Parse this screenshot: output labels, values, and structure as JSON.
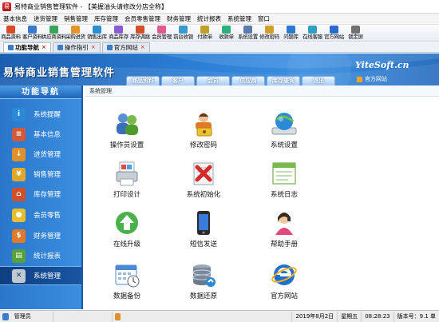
{
  "window": {
    "title": "易特商业销售管理软件 - 【美握油头请修改分店全称】"
  },
  "menubar": {
    "items": [
      "基本信息",
      "进货管理",
      "销售管理",
      "库存管理",
      "会员零售管理",
      "财务管理",
      "统计报表",
      "系统管理",
      "窗口"
    ]
  },
  "toolbar": {
    "items": [
      {
        "label": "商品资料",
        "icon": "product-icon",
        "color": "#d94a2a"
      },
      {
        "label": "客户资料",
        "icon": "customer-icon",
        "color": "#3a7bd0"
      },
      {
        "label": "供应商资料",
        "icon": "supplier-icon",
        "color": "#3aa35a"
      },
      {
        "label": "采购进货",
        "icon": "purchase-icon",
        "color": "#e0962a"
      },
      {
        "label": "销售出库",
        "icon": "sales-out-icon",
        "color": "#2a8fd0"
      },
      {
        "label": "商品库存",
        "icon": "inventory-icon",
        "color": "#8a5ad0"
      },
      {
        "label": "库存调拨",
        "icon": "transfer-icon",
        "color": "#d0502a"
      },
      {
        "label": "会员管理",
        "icon": "member-icon",
        "color": "#e05a8a"
      },
      {
        "label": "前台收银",
        "icon": "cashier-icon",
        "color": "#3a9ad0"
      },
      {
        "label": "付款单",
        "icon": "payment-icon",
        "color": "#c0a02a"
      },
      {
        "label": "收款单",
        "icon": "receipt-icon",
        "color": "#2ab07a"
      },
      {
        "label": "系统设置",
        "icon": "settings-icon",
        "color": "#5a7ab0"
      },
      {
        "label": "修改密码",
        "icon": "password-icon",
        "color": "#d0a02a"
      },
      {
        "label": "问题库",
        "icon": "help-icon",
        "color": "#2a7ad0"
      },
      {
        "label": "在线客服",
        "icon": "service-icon",
        "color": "#30a0c0"
      },
      {
        "label": "官方网站",
        "icon": "website-icon",
        "color": "#2a6ad0"
      },
      {
        "label": "锁定屏",
        "icon": "lock-icon",
        "color": "#707070"
      }
    ]
  },
  "tabs": [
    {
      "label": "功能导航",
      "active": true
    },
    {
      "label": "操作指引",
      "active": false
    },
    {
      "label": "官方网站",
      "active": false
    }
  ],
  "banner": {
    "app_title": "易特商业销售管理软件",
    "brand": "YiteSoft.cn",
    "home_link": "官方网站",
    "nav_tabs": [
      "商品资料",
      "客户",
      "会员",
      "供应商",
      "库存查询",
      "退出"
    ]
  },
  "sidebar": {
    "header": "功能导航",
    "items": [
      {
        "label": "系统提醒",
        "icon": "info-icon",
        "color": "#2a8ad8",
        "glyph": "i",
        "active": false
      },
      {
        "label": "基本信息",
        "icon": "basic-info-icon",
        "color": "#d05a3a",
        "glyph": "≡",
        "active": false
      },
      {
        "label": "进货管理",
        "icon": "stock-in-icon",
        "color": "#e0902a",
        "glyph": "↓",
        "active": false
      },
      {
        "label": "销售管理",
        "icon": "sales-icon",
        "color": "#e0a82a",
        "glyph": "¥",
        "active": false
      },
      {
        "label": "库存管理",
        "icon": "warehouse-icon",
        "color": "#d0502a",
        "glyph": "⌂",
        "active": false
      },
      {
        "label": "会员零售",
        "icon": "retail-icon",
        "color": "#e6c02a",
        "glyph": "●",
        "active": false
      },
      {
        "label": "财务管理",
        "icon": "finance-icon",
        "color": "#e07a2a",
        "glyph": "$",
        "active": false
      },
      {
        "label": "统计报表",
        "icon": "report-icon",
        "color": "#5aa03a",
        "glyph": "▤",
        "active": false
      },
      {
        "label": "系统管理",
        "icon": "system-icon",
        "color": "#c0c8d0",
        "glyph": "✕",
        "active": true
      }
    ]
  },
  "content": {
    "breadcrumb": "系统管理",
    "items": [
      {
        "label": "操作员设置",
        "icon": "operator-icon"
      },
      {
        "label": "修改密码",
        "icon": "password-icon"
      },
      {
        "label": "系统设置",
        "icon": "system-settings-icon"
      },
      {
        "label": "打印设计",
        "icon": "print-design-icon"
      },
      {
        "label": "系统初始化",
        "icon": "initialize-icon"
      },
      {
        "label": "系统日志",
        "icon": "system-log-icon"
      },
      {
        "label": "在线升级",
        "icon": "upgrade-icon"
      },
      {
        "label": "短信发送",
        "icon": "sms-icon"
      },
      {
        "label": "帮助手册",
        "icon": "help-manual-icon"
      },
      {
        "label": "数据备份",
        "icon": "backup-icon"
      },
      {
        "label": "数据还原",
        "icon": "restore-icon"
      },
      {
        "label": "官方网站",
        "icon": "website-icon"
      }
    ]
  },
  "statusbar": {
    "user": "管理员",
    "date": "2019年8月2日",
    "weekday": "星期五",
    "time": "08:28:23",
    "version_label": "版本号：",
    "version_value": "9.1 单"
  }
}
